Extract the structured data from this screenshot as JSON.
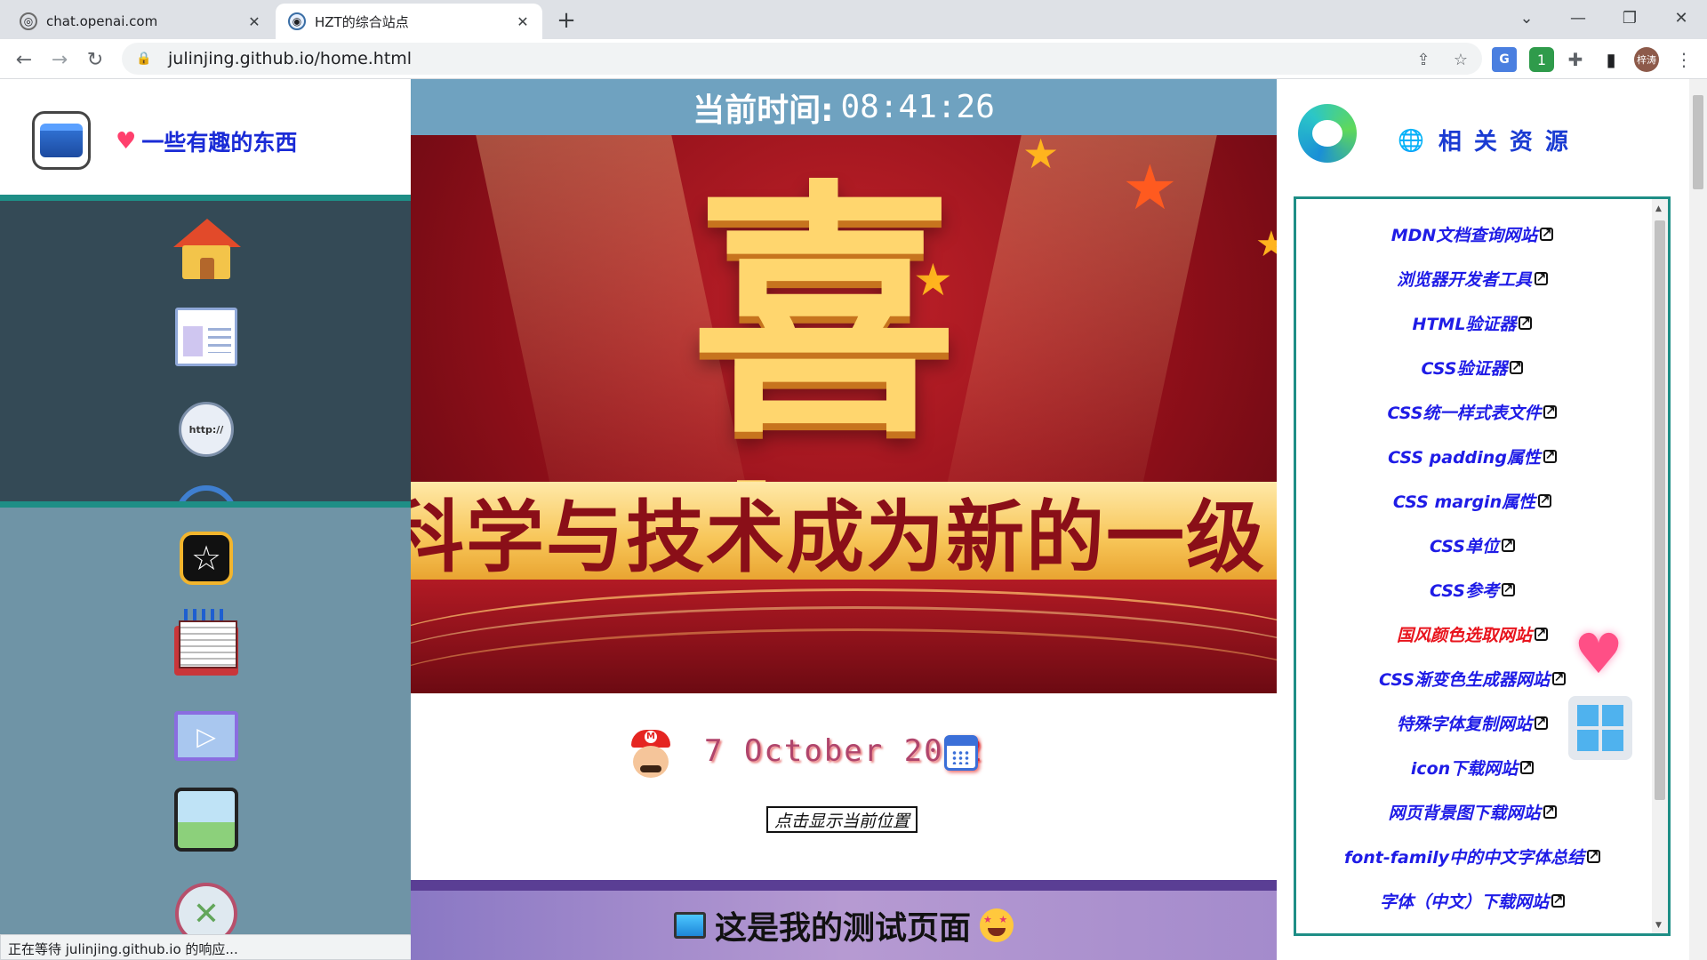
{
  "browser": {
    "tabs": [
      {
        "title": "chat.openai.com",
        "icon": "openai-icon",
        "close": "✕"
      },
      {
        "title": "HZT的综合站点",
        "icon": "site-globe-icon",
        "close": "✕"
      }
    ],
    "new_tab": "+",
    "address": "julinjing.github.io/home.html",
    "profile_label": "梓涛",
    "extension_badge": "1",
    "status": "正在等待 julinjing.github.io 的响应..."
  },
  "left": {
    "brand_heart": "♥",
    "brand_title": "一些有趣的东西",
    "nav_icons": [
      "home-icon",
      "webpage-icon",
      "http-link-icon",
      "refresh-icon",
      "star-icon",
      "book-icon",
      "video-icon",
      "gallery-icon",
      "x-circle-icon"
    ],
    "http_label": "http://"
  },
  "middle": {
    "clock_label": "当前时间:",
    "clock_time": "08:41:26",
    "banner_title": "喜报",
    "banner_strip": "科学与技术成为新的一级",
    "date": "7 October 2022",
    "locate_button": "点击显示当前位置",
    "test_title": "这是我的测试页面"
  },
  "right": {
    "title": "相关资源",
    "globe": "🌐",
    "links": [
      {
        "label": "MDN文档查询网站",
        "color": "#1f1ce6"
      },
      {
        "label": "浏览器开发者工具",
        "color": "#1f1ce6"
      },
      {
        "label": "HTML验证器",
        "color": "#1f1ce6"
      },
      {
        "label": "CSS验证器",
        "color": "#1f1ce6"
      },
      {
        "label": "CSS统一样式表文件",
        "color": "#1f1ce6"
      },
      {
        "label": "CSS padding属性",
        "color": "#1f1ce6"
      },
      {
        "label": "CSS margin属性",
        "color": "#1f1ce6"
      },
      {
        "label": "CSS单位",
        "color": "#1f1ce6"
      },
      {
        "label": "CSS参考",
        "color": "#1f1ce6"
      },
      {
        "label": "国风颜色选取网站",
        "color": "#e8141d"
      },
      {
        "label": "CSS渐变色生成器网站",
        "color": "#1f1ce6"
      },
      {
        "label": "特殊字体复制网站",
        "color": "#1f1ce6"
      },
      {
        "label": "icon下载网站",
        "color": "#1f1ce6"
      },
      {
        "label": "网页背景图下载网站",
        "color": "#1f1ce6"
      },
      {
        "label": "font-family中的中文字体总结",
        "color": "#1f1ce6"
      },
      {
        "label": "字体（中文）下载网站",
        "color": "#1f1ce6"
      }
    ],
    "link_icon": "↗",
    "badges": [
      "heart-icon",
      "windows-icon"
    ]
  }
}
